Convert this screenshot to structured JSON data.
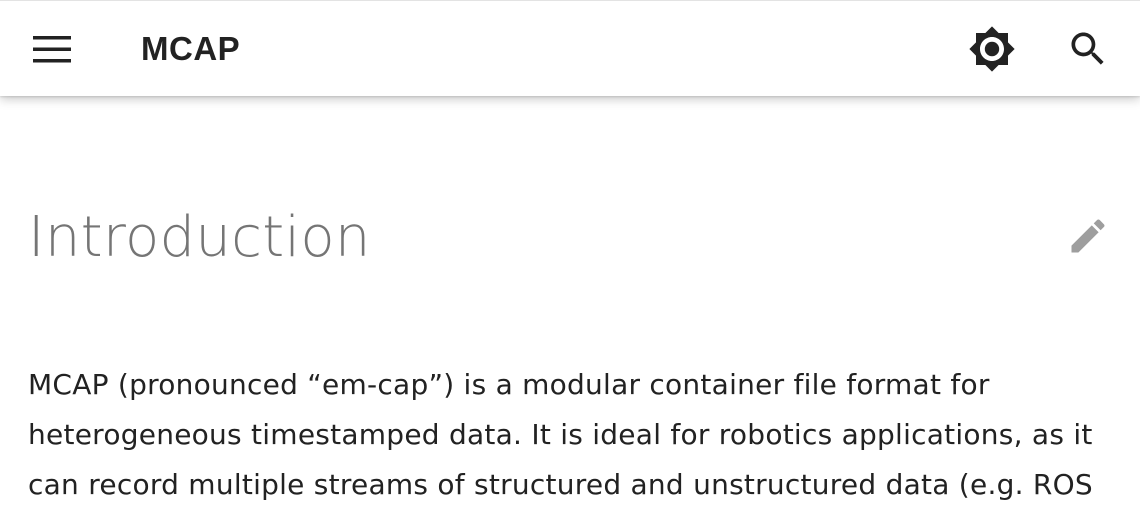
{
  "header": {
    "title": "MCAP",
    "icons": {
      "menu": "menu-icon",
      "palette": "brightness-icon",
      "search": "search-icon"
    }
  },
  "content": {
    "title": "Introduction",
    "edit_icon": "pencil-icon",
    "paragraph": "MCAP (pronounced “em-cap”) is a modular container file format for heterogeneous timestamped data. It is ideal for robotics applications, as it can record multiple streams of structured and unstructured data (e.g. ROS"
  },
  "colors": {
    "header_bg": "#ffffff",
    "title_text": "#222222",
    "heading_text": "#757575",
    "icon": "#222222",
    "edit_icon": "#9e9e9e"
  }
}
